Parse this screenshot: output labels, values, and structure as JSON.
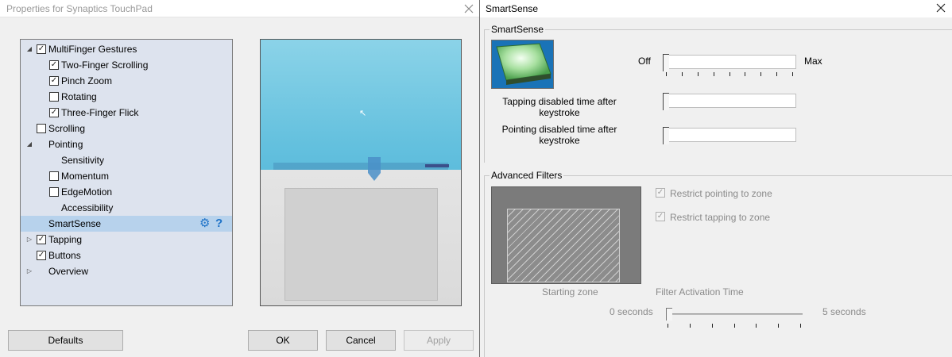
{
  "left_window": {
    "title": "Properties for Synaptics TouchPad",
    "tree": [
      {
        "label": "MultiFinger Gestures",
        "checkbox": true,
        "checked": true,
        "expander": "open",
        "level": 0
      },
      {
        "label": "Two-Finger Scrolling",
        "checkbox": true,
        "checked": true,
        "expander": "",
        "level": 1
      },
      {
        "label": "Pinch Zoom",
        "checkbox": true,
        "checked": true,
        "expander": "",
        "level": 1
      },
      {
        "label": "Rotating",
        "checkbox": true,
        "checked": false,
        "expander": "",
        "level": 1
      },
      {
        "label": "Three-Finger Flick",
        "checkbox": true,
        "checked": true,
        "expander": "",
        "level": 1
      },
      {
        "label": "Scrolling",
        "checkbox": true,
        "checked": false,
        "expander": "",
        "level": 0
      },
      {
        "label": "Pointing",
        "checkbox": false,
        "checked": false,
        "expander": "open",
        "level": 0
      },
      {
        "label": "Sensitivity",
        "checkbox": false,
        "checked": false,
        "expander": "",
        "level": 1
      },
      {
        "label": "Momentum",
        "checkbox": true,
        "checked": false,
        "expander": "",
        "level": 1
      },
      {
        "label": "EdgeMotion",
        "checkbox": true,
        "checked": false,
        "expander": "",
        "level": 1
      },
      {
        "label": "Accessibility",
        "checkbox": false,
        "checked": false,
        "expander": "",
        "level": 1
      },
      {
        "label": "SmartSense",
        "checkbox": false,
        "checked": false,
        "expander": "",
        "level": 0,
        "selected": true
      },
      {
        "label": "Tapping",
        "checkbox": true,
        "checked": true,
        "expander": "closed",
        "level": 0
      },
      {
        "label": "Buttons",
        "checkbox": true,
        "checked": true,
        "expander": "",
        "level": 0
      },
      {
        "label": "Overview",
        "checkbox": false,
        "checked": false,
        "expander": "closed",
        "level": 0
      }
    ],
    "buttons": {
      "defaults": "Defaults",
      "ok": "OK",
      "cancel": "Cancel",
      "apply": "Apply"
    }
  },
  "right_window": {
    "title": "SmartSense",
    "smartsense_group": {
      "legend": "SmartSense",
      "off_label": "Off",
      "max_label": "Max",
      "tapping_label": "Tapping disabled time after keystroke",
      "pointing_label": "Pointing disabled time after keystroke"
    },
    "advanced_group": {
      "legend": "Advanced Filters",
      "restrict_pointing": "Restrict pointing to zone",
      "restrict_tapping": "Restrict tapping to zone",
      "starting_zone": "Starting zone",
      "filter_activation_time": "Filter Activation Time",
      "min_seconds": "0 seconds",
      "max_seconds": "5 seconds"
    }
  },
  "colors": {
    "selection": "#b7d2ec",
    "tree_bg": "#dde3ee",
    "accent": "#1e73c8"
  }
}
